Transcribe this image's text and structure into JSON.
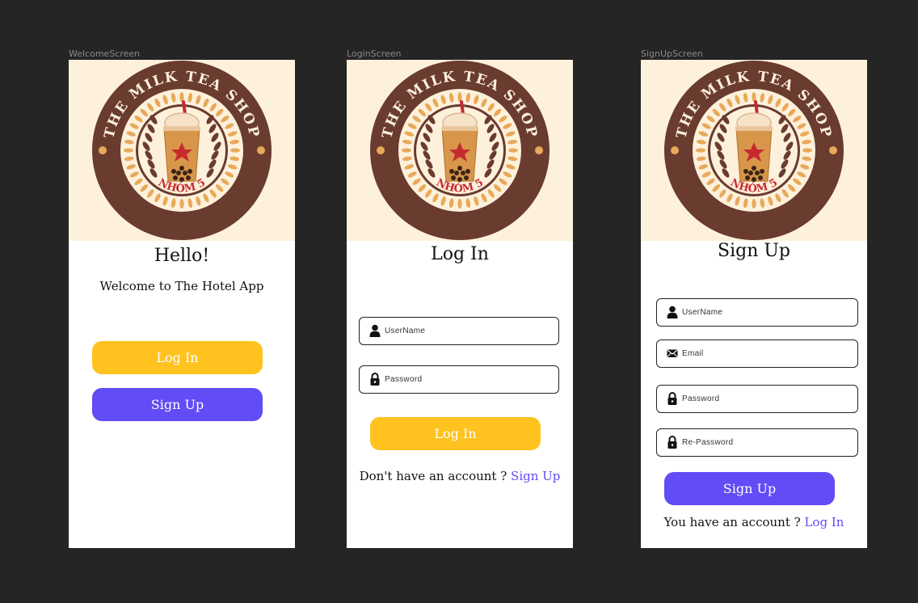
{
  "logo": {
    "arc_text": "THE MILK TEA SHOP",
    "group_text": "NHÓM 5",
    "colors": {
      "brown": "#6a3b2f",
      "cream": "#fdf1dc",
      "gold": "#e8a95a",
      "red": "#c62a2f"
    }
  },
  "welcome": {
    "frame_label": "WelcomeScreen",
    "title": "Hello!",
    "subtitle": "Welcome to The Hotel App",
    "login_button": "Log In",
    "signup_button": "Sign Up"
  },
  "login": {
    "frame_label": "LoginScreen",
    "title": "Log In",
    "username_placeholder": "UserName",
    "password_placeholder": "Password",
    "login_button": "Log In",
    "footer_prompt": "Don't have an account ?",
    "footer_link": "Sign Up"
  },
  "signup": {
    "frame_label": "SignUpScreen",
    "title": "Sign Up",
    "username_placeholder": "UserName",
    "email_placeholder": "Email",
    "password_placeholder": "Password",
    "repassword_placeholder": "Re-Password",
    "signup_button": "Sign Up",
    "footer_prompt": "You have an account ?",
    "footer_link": "Log In"
  },
  "colors": {
    "background": "#252525",
    "accent_yellow": "#ffc21f",
    "accent_purple": "#614cf5",
    "link": "#614cf5"
  }
}
